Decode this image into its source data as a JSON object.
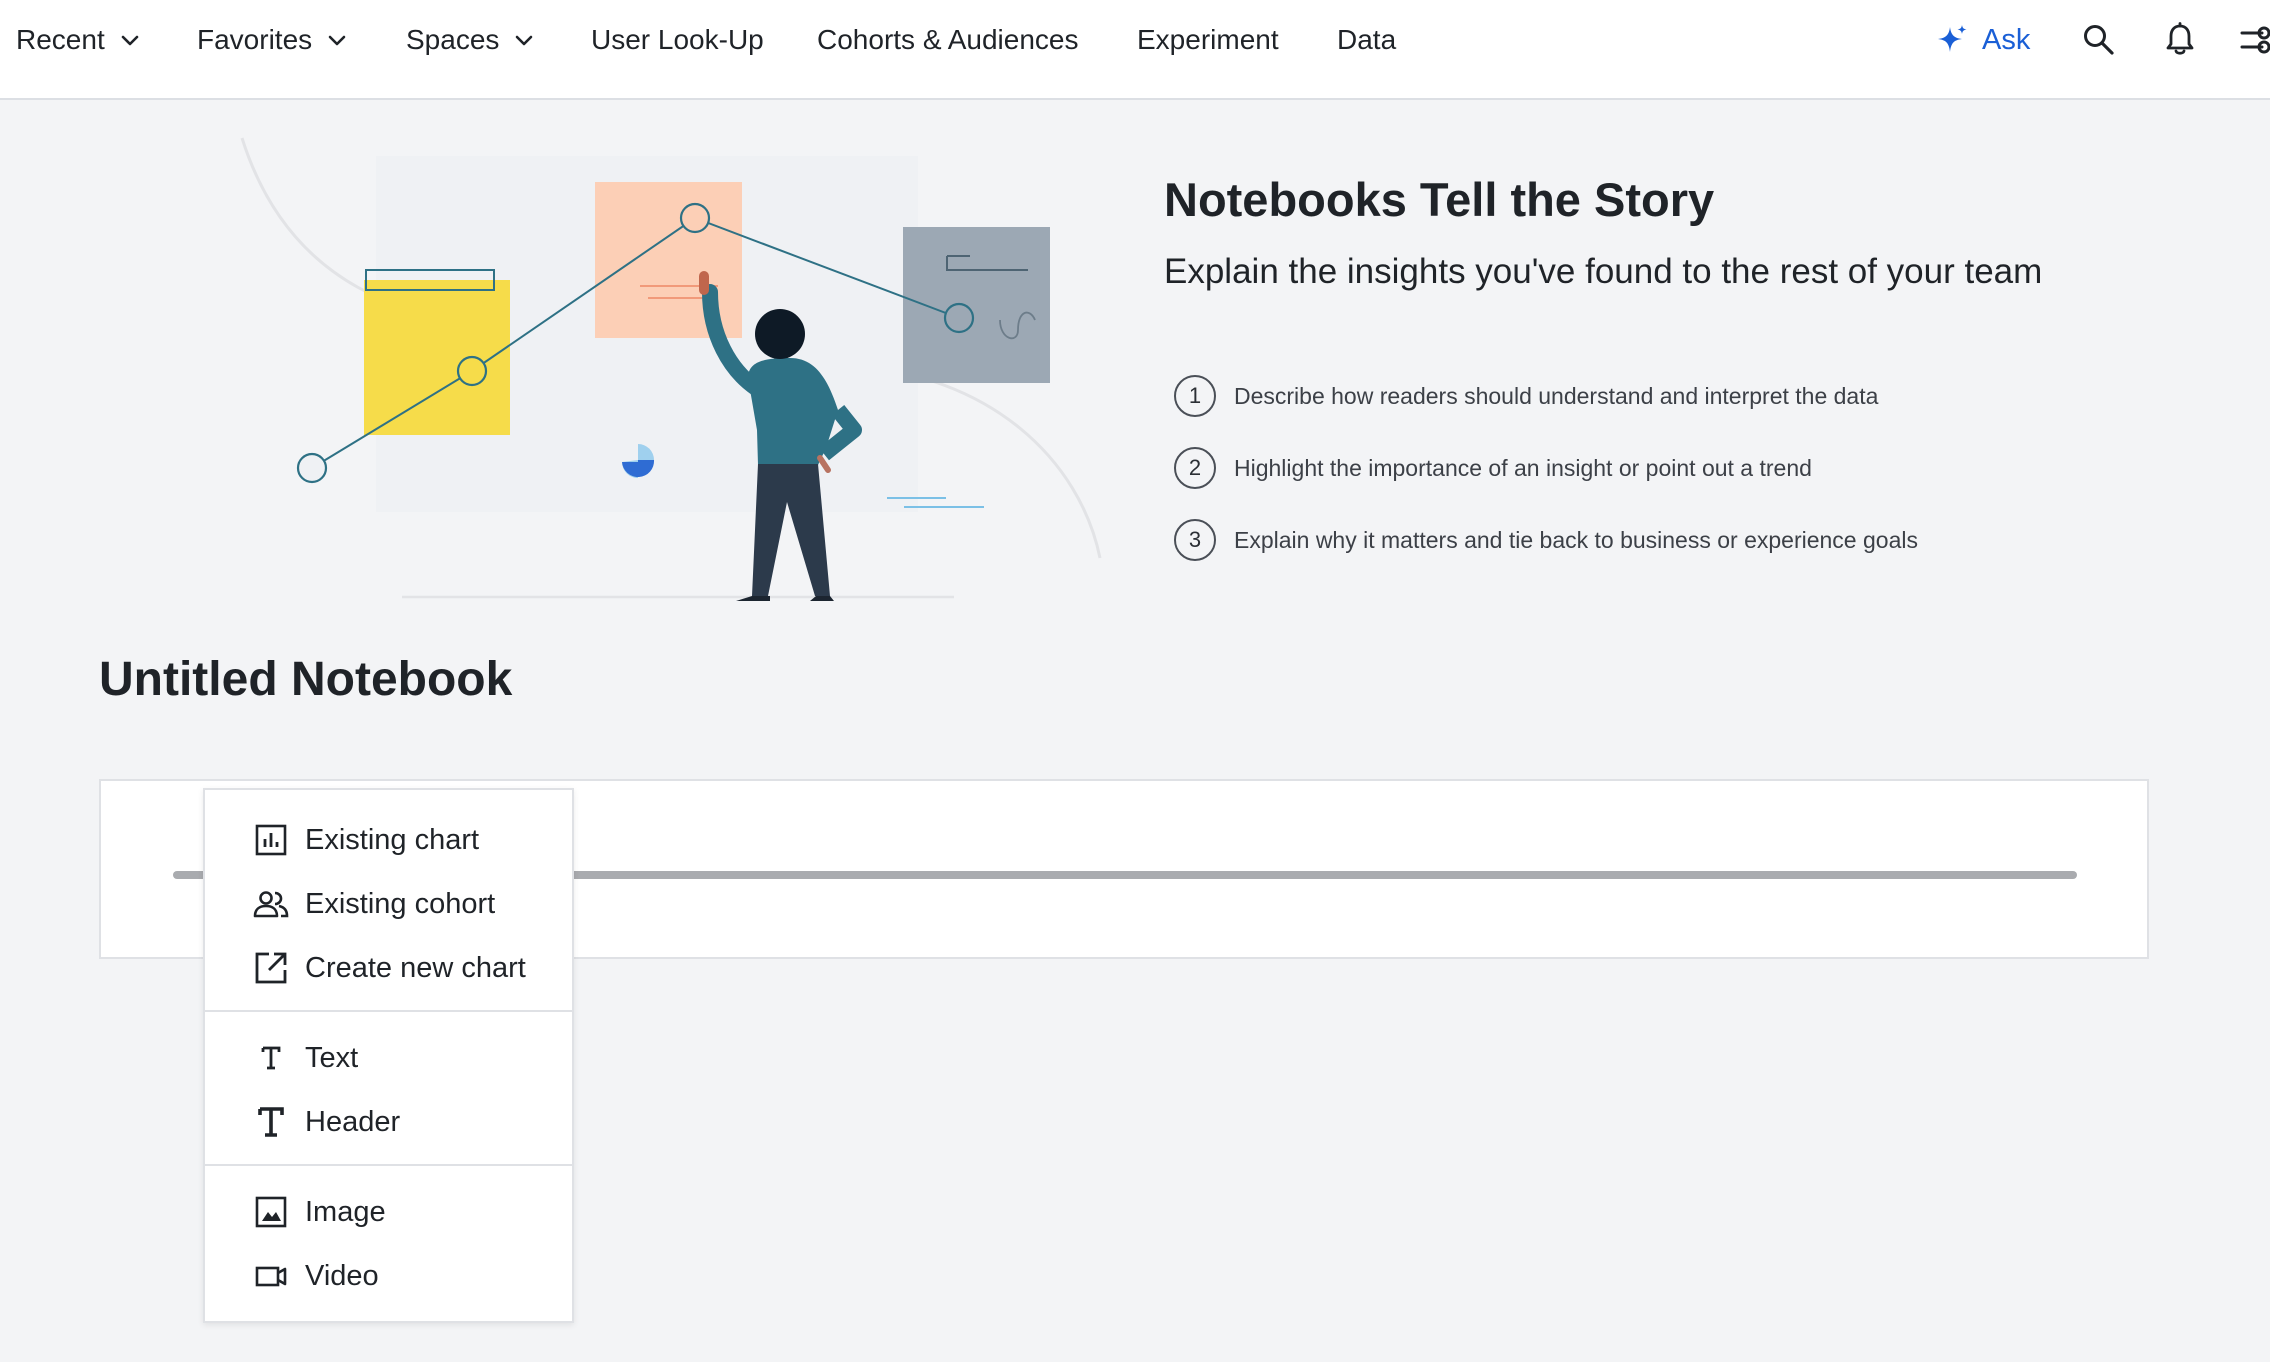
{
  "nav": {
    "items": [
      {
        "label": "Recent",
        "dropdown": true
      },
      {
        "label": "Favorites",
        "dropdown": true
      },
      {
        "label": "Spaces",
        "dropdown": true
      },
      {
        "label": "User Look-Up",
        "dropdown": false
      },
      {
        "label": "Cohorts & Audiences",
        "dropdown": false
      },
      {
        "label": "Experiment",
        "dropdown": false
      },
      {
        "label": "Data",
        "dropdown": false
      }
    ],
    "ask_label": "Ask",
    "icons": [
      "sparkle-icon",
      "search-icon",
      "bell-icon",
      "settings-toggle-icon"
    ]
  },
  "hero": {
    "title": "Notebooks Tell the Story",
    "subtitle": "Explain the insights you've found to the rest of your team",
    "steps": [
      {
        "number": "1",
        "text": "Describe how readers should understand and interpret the data"
      },
      {
        "number": "2",
        "text": "Highlight the importance of an insight or point out a trend"
      },
      {
        "number": "3",
        "text": "Explain why it matters and tie back to business or experience goals"
      }
    ]
  },
  "notebook": {
    "title": "Untitled Notebook"
  },
  "menu": {
    "items": [
      {
        "label": "Existing chart",
        "icon": "bar-chart-icon"
      },
      {
        "label": "Existing cohort",
        "icon": "people-icon"
      },
      {
        "label": "Create new chart",
        "icon": "external-link-icon"
      },
      {
        "label": "Text",
        "icon": "text-icon"
      },
      {
        "label": "Header",
        "icon": "header-icon"
      },
      {
        "label": "Image",
        "icon": "image-icon"
      },
      {
        "label": "Video",
        "icon": "video-icon"
      }
    ]
  },
  "colors": {
    "accent": "#1a5fd6",
    "background": "#f3f4f6",
    "yellow_note": "#f6dc4a",
    "peach_note": "#fccfb6",
    "gray_note": "#9ca8b4",
    "figure_shirt": "#2e7185",
    "figure_pants": "#2c3a4b"
  }
}
